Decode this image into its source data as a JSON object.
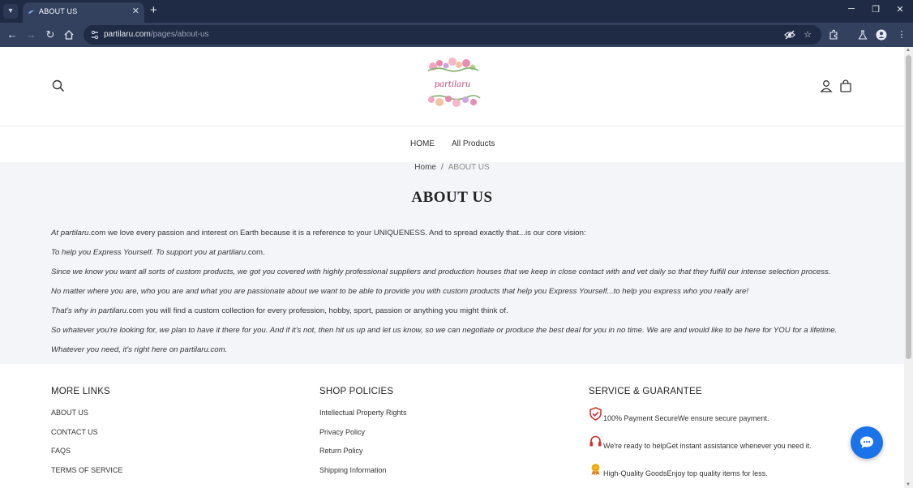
{
  "browser": {
    "tab_title": "ABOUT US",
    "url_host": "partilaru.com",
    "url_path": "/pages/about-us"
  },
  "header": {
    "logo_text": "partilaru"
  },
  "nav": {
    "items": [
      "HOME",
      "All Products"
    ]
  },
  "breadcrumb": {
    "home": "Home",
    "separator": "/",
    "current": "ABOUT US"
  },
  "page_title": "ABOUT US",
  "about": {
    "p1": {
      "a": "At partilaru",
      "b": ".com we love every passion and interest on Earth because it is a reference to your UNIQUENESS. And to spread exactly that...is our core vision:"
    },
    "p2": {
      "a": "To help you Express Yourself. To support you at partilaru",
      "b": ".com."
    },
    "p3": "Since we know you want all sorts of custom products, we got you covered with highly professional suppliers and production houses that we keep in close contact with and vet daily so that they fulfill our intense selection process.",
    "p4": "No matter where you are, who you are and what you are passionate about we want to be able to provide you with custom products that help you Express Yourself...to help you express who you really are!",
    "p5": {
      "a": "That's why in partilaru",
      "b": ".com you will find a custom collection for every profession, hobby, sport, passion or anything you might think of."
    },
    "p6": "So whatever you're looking for, we plan to have it there for you. And if it's not, then hit us up and let us know, so we can negotiate or produce the best deal for you in no time. We are and would like to be here for YOU for a lifetime.",
    "p7": "Whatever you need, it's right here on partilaru.com."
  },
  "footer": {
    "more_links": {
      "heading": "MORE LINKS",
      "items": [
        "ABOUT US",
        "CONTACT US",
        "FAQS",
        "TERMS OF SERVICE"
      ]
    },
    "shop_policies": {
      "heading": "SHOP POLICIES",
      "items": [
        "Intellectual Property Rights",
        "Privacy Policy",
        "Return Policy",
        "Shipping Information"
      ]
    },
    "service": {
      "heading": "SERVICE & GUARANTEE",
      "items": [
        {
          "icon": "shield-check-icon",
          "text": "100% Payment SecureWe ensure secure payment."
        },
        {
          "icon": "headset-icon",
          "text": "We're ready to helpGet instant assistance whenever you need it."
        },
        {
          "icon": "medal-icon",
          "text": "High-Quality GoodsEnjoy top quality items for less."
        }
      ]
    }
  },
  "colors": {
    "chrome_dark": "#1f2a44",
    "chrome_toolbar": "#33415f",
    "content_bg": "#f3f5f9",
    "chat_blue": "#1a73e8",
    "icon_red": "#d62b2b"
  }
}
